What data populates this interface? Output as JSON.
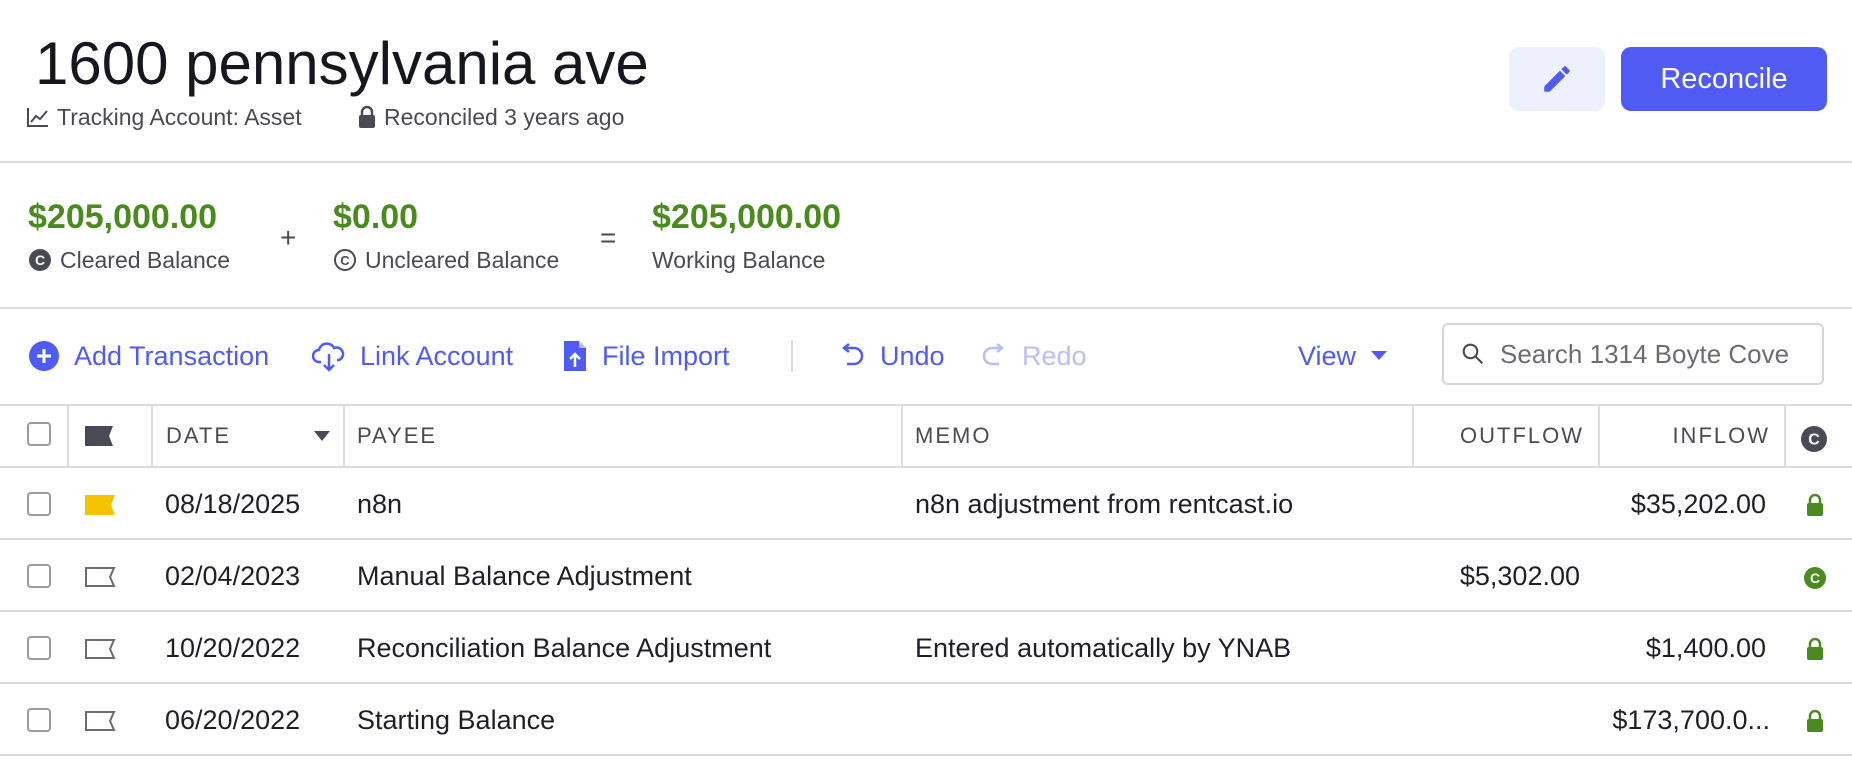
{
  "header": {
    "account_name": "1600 pennsylvania ave",
    "account_type": "Tracking Account: Asset",
    "reconciled": "Reconciled 3 years ago",
    "reconcile_label": "Reconcile"
  },
  "balances": {
    "cleared_amount": "$205,000.00",
    "cleared_label": "Cleared Balance",
    "plus": "+",
    "uncleared_amount": "$0.00",
    "uncleared_label": "Uncleared Balance",
    "equals": "=",
    "working_amount": "$205,000.00",
    "working_label": "Working Balance",
    "positive_color": "#4a8a1f"
  },
  "toolbar": {
    "add_transaction": "Add Transaction",
    "link_account": "Link Account",
    "file_import": "File Import",
    "undo": "Undo",
    "redo": "Redo",
    "view": "View",
    "search_placeholder": "Search 1314 Boyte Cove",
    "accent_color": "#4f5bf2"
  },
  "table": {
    "columns": {
      "date": "DATE",
      "payee": "PAYEE",
      "memo": "MEMO",
      "outflow": "OUTFLOW",
      "inflow": "INFLOW"
    },
    "rows": [
      {
        "date": "08/18/2025",
        "payee": "n8n",
        "memo": "n8n adjustment from rentcast.io",
        "outflow": "",
        "inflow": "$35,202.00",
        "flag": "yellow-flag-icon",
        "status": "lock-icon"
      },
      {
        "date": "02/04/2023",
        "payee": "Manual Balance Adjustment",
        "memo": "",
        "outflow": "$5,302.00",
        "inflow": "",
        "flag": "empty-flag-icon",
        "status": "cleared-icon"
      },
      {
        "date": "10/20/2022",
        "payee": "Reconciliation Balance Adjustment",
        "memo": "Entered automatically by YNAB",
        "outflow": "",
        "inflow": "$1,400.00",
        "flag": "empty-flag-icon",
        "status": "lock-icon"
      },
      {
        "date": "06/20/2022",
        "payee": "Starting Balance",
        "memo": "",
        "outflow": "",
        "inflow": "$173,700.0...",
        "flag": "empty-flag-icon",
        "status": "lock-icon"
      }
    ]
  }
}
